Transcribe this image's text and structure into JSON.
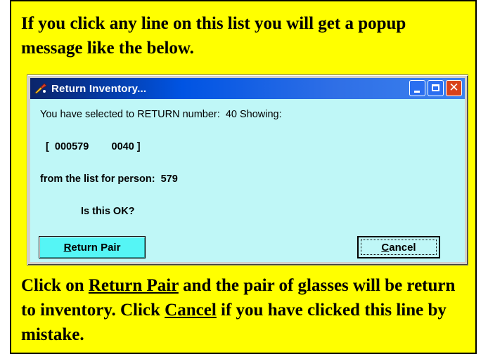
{
  "intro_text": "If you click any line on this list you will get a popup message like the below.",
  "dialog": {
    "title": "Return Inventory...",
    "message_line1": "You have selected to RETURN number:  40 Showing:",
    "message_line2": "[  000579        0040 ]",
    "message_line3": "from the list for person:  579",
    "message_line4": "Is this OK?",
    "return_button": {
      "accel": "R",
      "rest": "eturn Pair"
    },
    "cancel_button": {
      "accel": "C",
      "rest": "ancel"
    },
    "colors": {
      "client_bg": "#bff7f7",
      "return_btn": "#55f5f5",
      "titlebar": "#0054e3"
    }
  },
  "outro": {
    "part1": "Click on ",
    "link1": "Return Pair",
    "part2": " and the pair of glasses will be return to inventory.  Click ",
    "link2": "Cancel",
    "part3": " if you have clicked this line by mistake."
  },
  "panel_bg": "#ffff00",
  "icons": [
    "app-icon",
    "minimize-icon",
    "maximize-icon",
    "close-icon"
  ]
}
